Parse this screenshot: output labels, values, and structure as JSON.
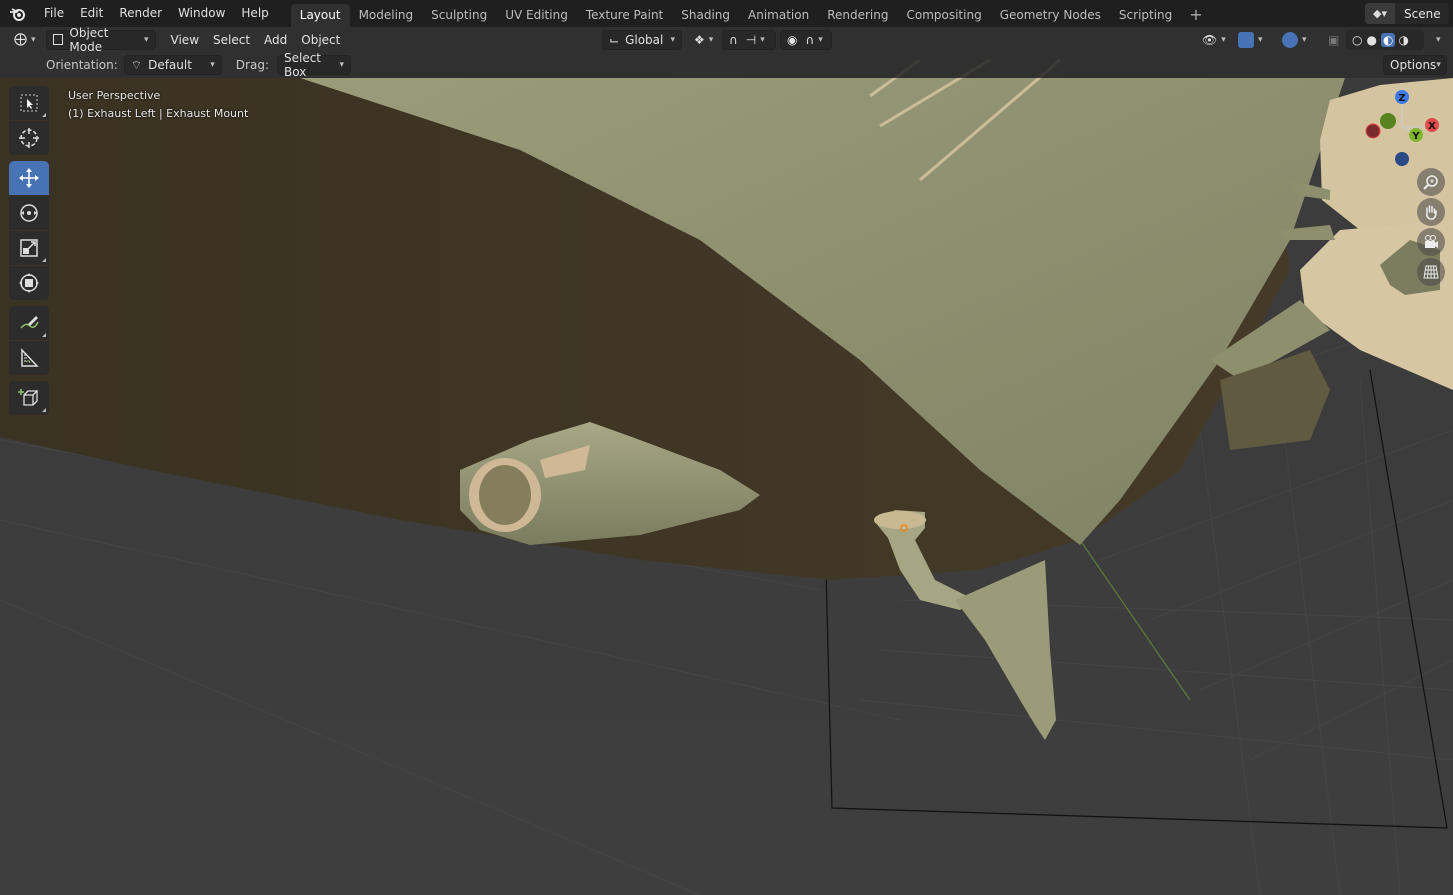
{
  "topbar": {
    "menus": [
      "File",
      "Edit",
      "Render",
      "Window",
      "Help"
    ],
    "tabs": [
      "Layout",
      "Modeling",
      "Sculpting",
      "UV Editing",
      "Texture Paint",
      "Shading",
      "Animation",
      "Rendering",
      "Compositing",
      "Geometry Nodes",
      "Scripting"
    ],
    "active_tab": "Layout",
    "add_tab": "+",
    "scene": "Scene"
  },
  "header": {
    "mode": "Object Mode",
    "menus": [
      "View",
      "Select",
      "Add",
      "Object"
    ],
    "transform_orientation": "Global"
  },
  "tool_settings": {
    "orientation_label": "Orientation:",
    "orientation_value": "Default",
    "drag_label": "Drag:",
    "drag_value": "Select Box",
    "options": "Options"
  },
  "viewport": {
    "view_name": "User Perspective",
    "active_object": "(1) Exhaust Left | Exhaust Mount"
  },
  "gizmo": {
    "x": "X",
    "y": "Y",
    "z": "Z"
  },
  "colors": {
    "active_blue": "#4772b3",
    "axis_x": "#e34a4a",
    "axis_y": "#7fb52c",
    "axis_z": "#3f7be8",
    "model_green": "#8e8f6d",
    "model_beige": "#d2c09e"
  },
  "tools": [
    "select-box",
    "cursor",
    "move",
    "rotate",
    "scale",
    "transform",
    "annotate",
    "measure",
    "add-cube"
  ]
}
